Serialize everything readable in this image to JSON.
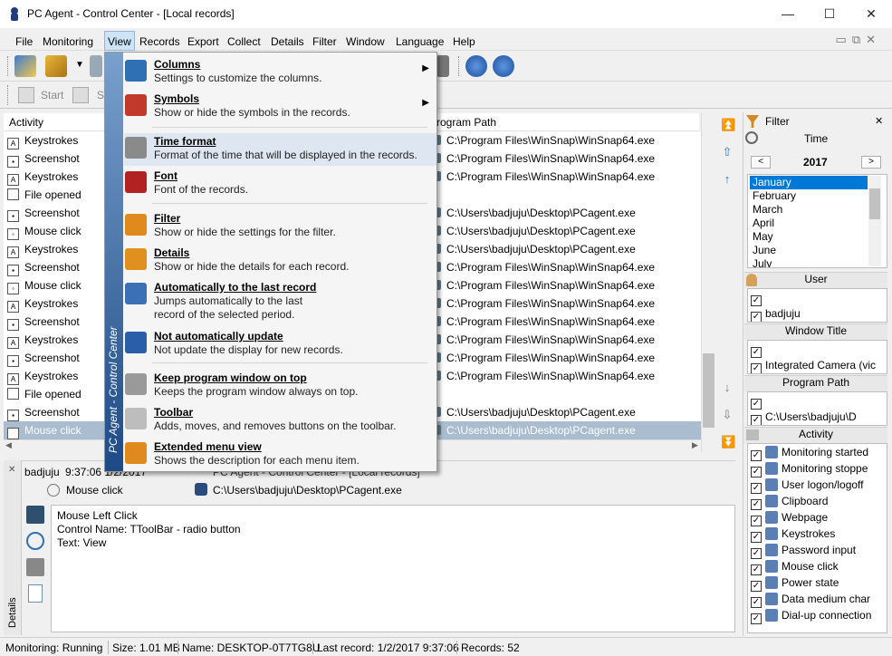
{
  "window": {
    "title": "PC Agent - Control Center - [Local records]",
    "minimize": "—",
    "maximize": "☐",
    "close": "✕"
  },
  "menubar": [
    "File",
    "Monitoring",
    "View",
    "Records",
    "Export",
    "Collect",
    "Details",
    "Filter",
    "Window",
    "Language",
    "Help"
  ],
  "toolbar2": {
    "start": "Start",
    "s": "S"
  },
  "grid": {
    "col_activity": "Activity",
    "col_path": "rogram Path",
    "rows": [
      {
        "activity": "Keystrokes",
        "icon": "A",
        "path": "C:\\Program Files\\WinSnap\\WinSnap64.exe"
      },
      {
        "activity": "Screenshot",
        "icon": "▪",
        "path": "C:\\Program Files\\WinSnap\\WinSnap64.exe"
      },
      {
        "activity": "Keystrokes",
        "icon": "A",
        "path": "C:\\Program Files\\WinSnap\\WinSnap64.exe"
      },
      {
        "activity": "File opened",
        "icon": "",
        "path": ""
      },
      {
        "activity": "Screenshot",
        "icon": "▪",
        "path": "C:\\Users\\badjuju\\Desktop\\PCagent.exe"
      },
      {
        "activity": "Mouse click",
        "icon": "◦",
        "path": "C:\\Users\\badjuju\\Desktop\\PCagent.exe"
      },
      {
        "activity": "Keystrokes",
        "icon": "A",
        "path": "C:\\Users\\badjuju\\Desktop\\PCagent.exe"
      },
      {
        "activity": "Screenshot",
        "icon": "▪",
        "path": "C:\\Program Files\\WinSnap\\WinSnap64.exe"
      },
      {
        "activity": "Mouse click",
        "icon": "◦",
        "path": "C:\\Program Files\\WinSnap\\WinSnap64.exe"
      },
      {
        "activity": "Keystrokes",
        "icon": "A",
        "path": "C:\\Program Files\\WinSnap\\WinSnap64.exe"
      },
      {
        "activity": "Screenshot",
        "icon": "▪",
        "path": "C:\\Program Files\\WinSnap\\WinSnap64.exe"
      },
      {
        "activity": "Keystrokes",
        "icon": "A",
        "path": "C:\\Program Files\\WinSnap\\WinSnap64.exe"
      },
      {
        "activity": "Screenshot",
        "icon": "▪",
        "path": "C:\\Program Files\\WinSnap\\WinSnap64.exe"
      },
      {
        "activity": "Keystrokes",
        "icon": "A",
        "path": "C:\\Program Files\\WinSnap\\WinSnap64.exe"
      },
      {
        "activity": "File opened",
        "icon": "",
        "path": ""
      },
      {
        "activity": "Screenshot",
        "icon": "▪",
        "path": "C:\\Users\\badjuju\\Desktop\\PCagent.exe"
      },
      {
        "activity": "Mouse click",
        "icon": "◦",
        "path": "C:\\Users\\badjuju\\Desktop\\PCagent.exe"
      }
    ]
  },
  "view_menu": [
    {
      "title": "Columns",
      "desc": "Settings to customize the columns.",
      "sub": true,
      "icon_color": "#2f6fb4"
    },
    {
      "title": "Symbols",
      "desc": "Show or hide the symbols in the records.",
      "sub": true,
      "icon_color": "#c0392b"
    },
    {
      "title": "Time format",
      "desc": "Format of the time that will be displayed in the records.",
      "sub": false,
      "icon_color": "#8a8a8a"
    },
    {
      "title": "Font",
      "desc": "Font of the records.",
      "sub": false,
      "icon_color": "#b22222"
    },
    {
      "title": "Filter",
      "desc": "Show or hide the settings for the filter.",
      "sub": false,
      "icon_color": "#e08a1e"
    },
    {
      "title": "Details",
      "desc": "Show or hide the details for each record.",
      "sub": false,
      "icon_color": "#e0901e"
    },
    {
      "title": "Automatically to the last record",
      "desc": "Jumps automatically to the last",
      "desc2": "record of the selected period.",
      "sub": false,
      "icon_color": "#3b6fb6"
    },
    {
      "title": "Not automatically update",
      "desc": "Not update the display for new records.",
      "sub": false,
      "icon_color": "#2a5ea8"
    },
    {
      "title": "Keep program window on top",
      "desc": "Keeps the program window always on top.",
      "sub": false,
      "icon_color": "#9a9a9a"
    },
    {
      "title": "Toolbar",
      "desc": "Adds, moves, and removes buttons on the toolbar.",
      "sub": false,
      "icon_color": "#bdbdbd"
    },
    {
      "title": "Extended menu view",
      "desc": "Shows the description for each menu item.",
      "sub": false,
      "icon_color": "#e08a1e"
    }
  ],
  "menu_side_text": "PC Agent - Control Center",
  "details": {
    "user": "badjuju",
    "time": "9:37:06",
    "date_partial": "9:37:06  1/2/2017",
    "window_title_partial": "PC Agent - Control Center - [Local records]",
    "activity": "Mouse click",
    "path": "C:\\Users\\badjuju\\Desktop\\PCagent.exe",
    "lines": [
      "Mouse Left Click",
      "Control Name: TToolBar - radio button",
      "Text: View"
    ],
    "tab_label": "Details"
  },
  "filter": {
    "title": "Filter",
    "time": "Time",
    "year": "2017",
    "prev": "<",
    "next": ">",
    "months": [
      "January",
      "February",
      "March",
      "April",
      "May",
      "June",
      "July"
    ],
    "user_header": "User",
    "users": [
      "",
      "badjuju"
    ],
    "window_title_header": "Window Title",
    "window_titles": [
      "",
      "Integrated Camera (vic"
    ],
    "program_path_header": "Program Path",
    "program_paths": [
      "",
      "C:\\Users\\badjuju\\D"
    ],
    "activity_header": "Activity",
    "activities": [
      "Monitoring started",
      "Monitoring stoppe",
      "User logon/logoff",
      "Clipboard",
      "Webpage",
      "Keystrokes",
      "Password input",
      "Mouse click",
      "Power state",
      "Data medium char",
      "Dial-up connection"
    ]
  },
  "status": {
    "monitoring": "Monitoring: Running",
    "size": "Size: 1.01 MB",
    "name": "Name: DESKTOP-0T7TG8U",
    "last": "Last record: 1/2/2017 9:37:06",
    "records": "Records: 52"
  }
}
